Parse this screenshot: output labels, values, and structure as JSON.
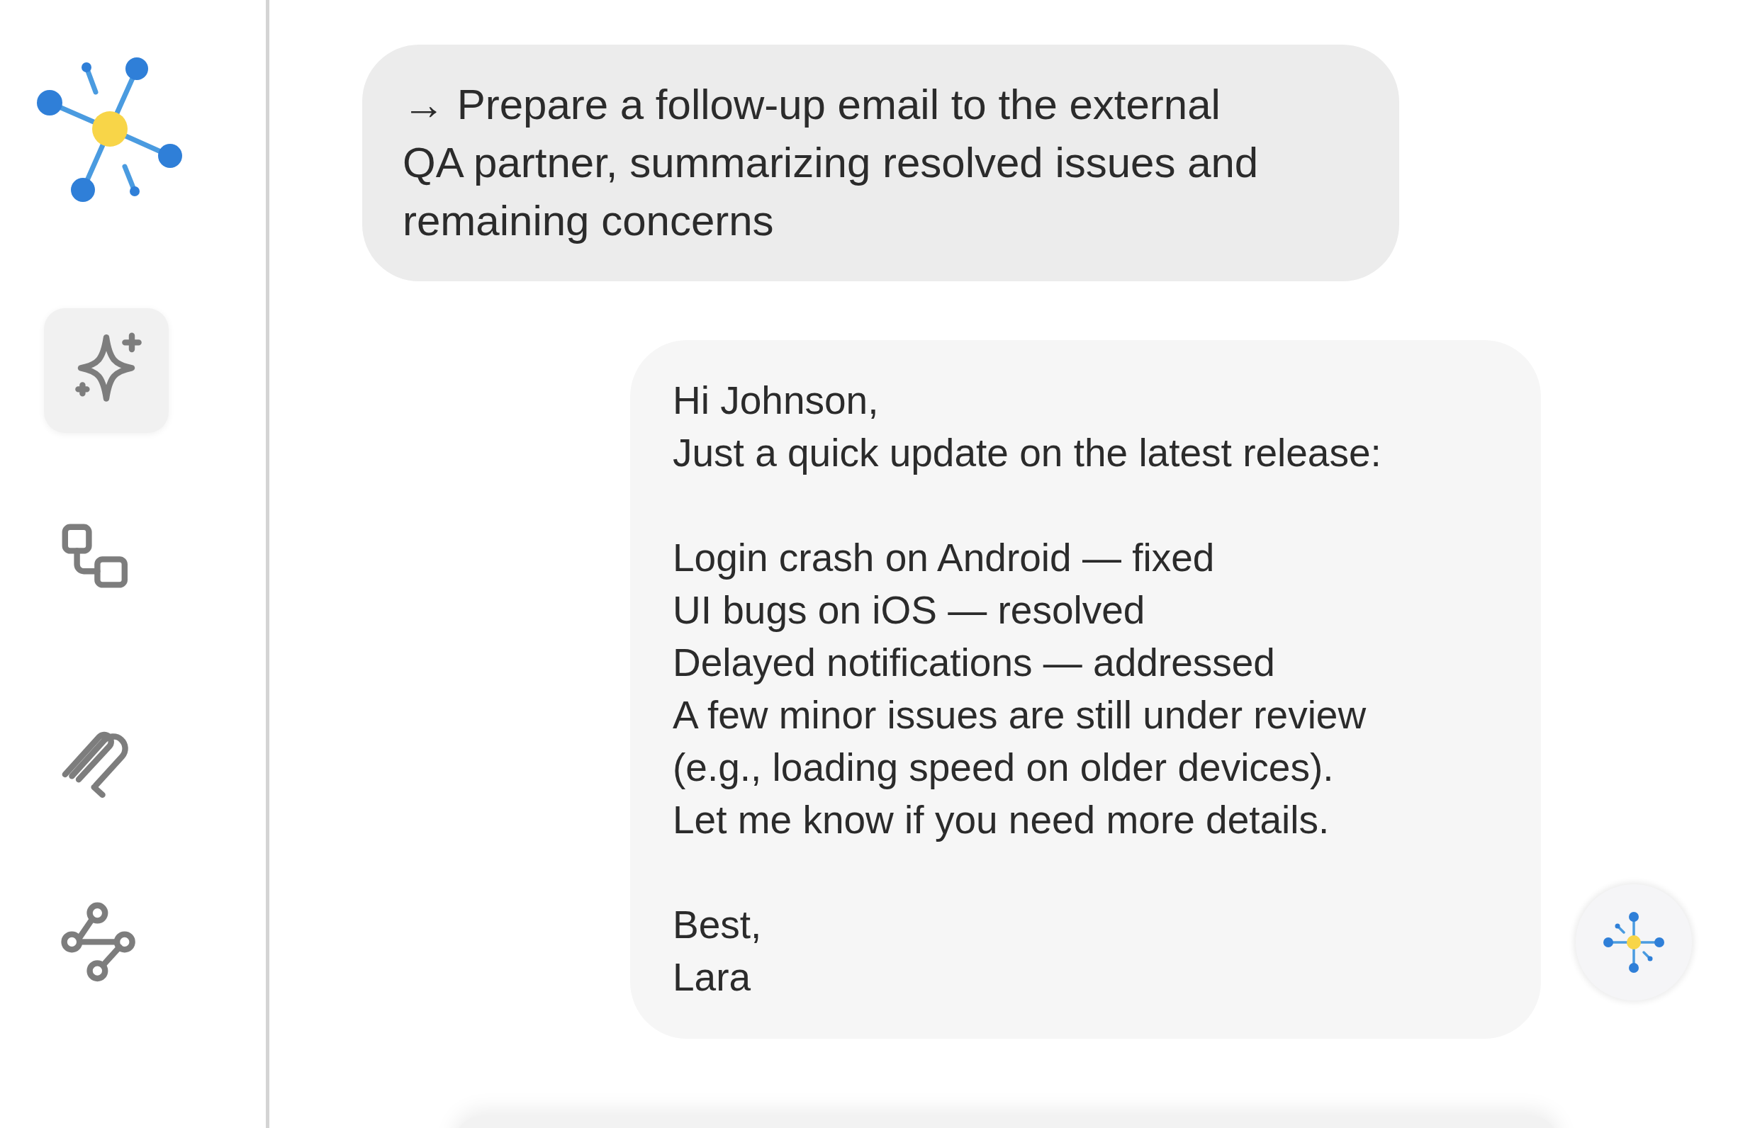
{
  "sidebar": {
    "items": [
      {
        "kind": "sparkle",
        "selected": true
      },
      {
        "kind": "flow",
        "selected": false
      },
      {
        "kind": "clip",
        "selected": false
      },
      {
        "kind": "nodes",
        "selected": false
      }
    ]
  },
  "messages": [
    {
      "kind": "user",
      "text": "→ Prepare a follow-up email to the external QA partner, summarizing resolved issues and remaining concerns"
    },
    {
      "kind": "reply",
      "paragraphs": [
        {
          "lines": [
            "Hi Johnson,",
            "Just a quick update on the latest release:"
          ]
        },
        {
          "lines": [
            "Login crash on Android — fixed",
            "UI bugs on iOS — resolved",
            "Delayed notifications — addressed",
            "A few minor issues are still under review",
            "(e.g., loading speed on older devices).",
            "Let me know if you need more details."
          ]
        },
        {
          "lines": [
            "Best,",
            "Lara"
          ]
        }
      ]
    }
  ]
}
